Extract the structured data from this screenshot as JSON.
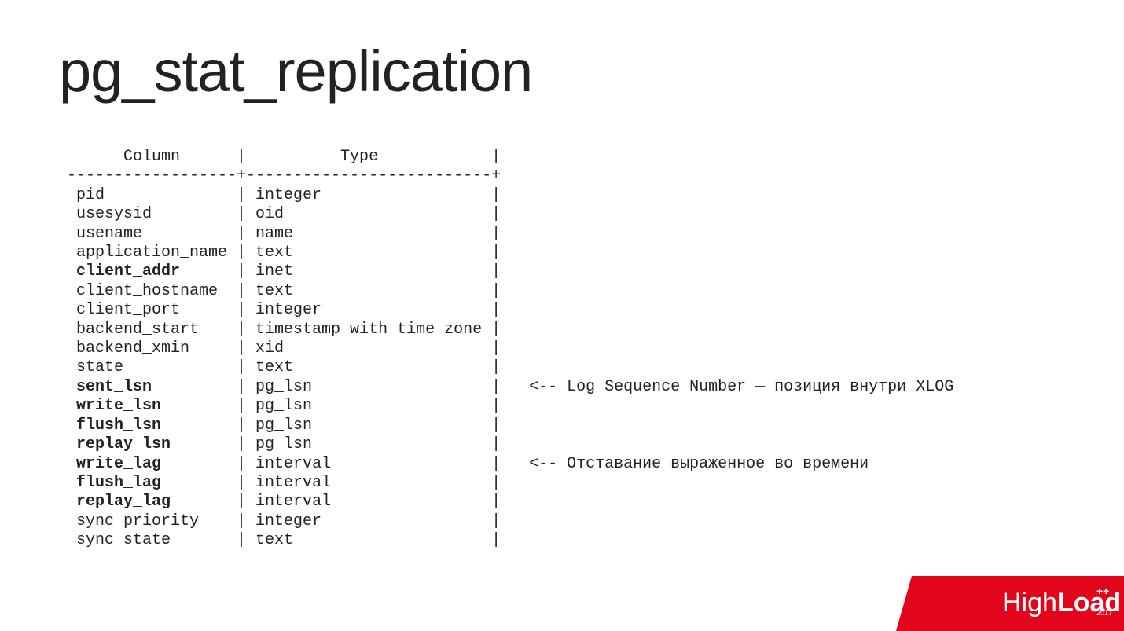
{
  "title": "pg_stat_replication",
  "header": {
    "col1": "      Column      ",
    "col2": "          Type            "
  },
  "separator": "------------------+--------------------------+",
  "rows": [
    {
      "col": " pid              ",
      "type": " integer                  ",
      "note": "",
      "bold": false
    },
    {
      "col": " usesysid         ",
      "type": " oid                      ",
      "note": "",
      "bold": false
    },
    {
      "col": " usename          ",
      "type": " name                     ",
      "note": "",
      "bold": false
    },
    {
      "col": " application_name ",
      "type": " text                     ",
      "note": "",
      "bold": false
    },
    {
      "col": " client_addr      ",
      "type": " inet                     ",
      "note": "",
      "bold": true
    },
    {
      "col": " client_hostname  ",
      "type": " text                     ",
      "note": "",
      "bold": false
    },
    {
      "col": " client_port      ",
      "type": " integer                  ",
      "note": "",
      "bold": false
    },
    {
      "col": " backend_start    ",
      "type": " timestamp with time zone ",
      "note": "",
      "bold": false
    },
    {
      "col": " backend_xmin     ",
      "type": " xid                      ",
      "note": "",
      "bold": false
    },
    {
      "col": " state            ",
      "type": " text                     ",
      "note": "",
      "bold": false
    },
    {
      "col": " sent_lsn         ",
      "type": " pg_lsn                   ",
      "note": "   <-- Log Sequence Number — позиция внутри XLOG",
      "bold": true
    },
    {
      "col": " write_lsn        ",
      "type": " pg_lsn                   ",
      "note": "",
      "bold": true
    },
    {
      "col": " flush_lsn        ",
      "type": " pg_lsn                   ",
      "note": "",
      "bold": true
    },
    {
      "col": " replay_lsn       ",
      "type": " pg_lsn                   ",
      "note": "",
      "bold": true
    },
    {
      "col": " write_lag        ",
      "type": " interval                 ",
      "note": "   <-- Отставание выраженное во времени",
      "bold": true
    },
    {
      "col": " flush_lag        ",
      "type": " interval                 ",
      "note": "",
      "bold": true
    },
    {
      "col": " replay_lag       ",
      "type": " interval                 ",
      "note": "",
      "bold": true
    },
    {
      "col": " sync_priority    ",
      "type": " integer                  ",
      "note": "",
      "bold": false
    },
    {
      "col": " sync_state       ",
      "type": " text                     ",
      "note": "",
      "bold": false
    }
  ],
  "logo": {
    "text_high": "High",
    "text_load": "Load",
    "text_year": "2017",
    "text_plus": "++"
  }
}
